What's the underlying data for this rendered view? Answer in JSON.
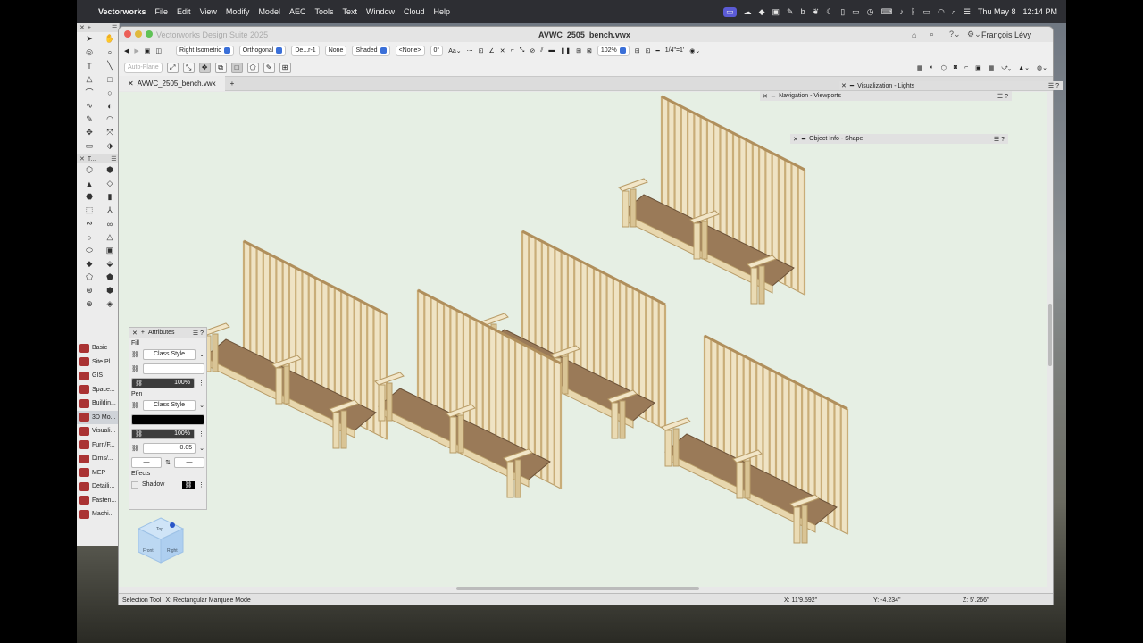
{
  "menubar": {
    "app": "Vectorworks",
    "items": [
      "File",
      "Edit",
      "View",
      "Modify",
      "Model",
      "AEC",
      "Tools",
      "Text",
      "Window",
      "Cloud",
      "Help"
    ],
    "date": "Thu May 8",
    "time": "12:14 PM"
  },
  "window": {
    "suite_title": "Vectorworks Design Suite 2025",
    "doc_title": "AVWC_2505_bench.vwx",
    "user": "François Lévy"
  },
  "toolbar": {
    "view": "Right Isometric",
    "projection": "Orthogonal",
    "layer": "De...r-1",
    "class": "None",
    "render": "Shaded",
    "none_sel": "<None>",
    "angle": "0°",
    "zoom": "102%",
    "scale": "1/4\"=1'",
    "auto_plane": "Auto-Plane"
  },
  "tab": {
    "label": "AVWC_2505_bench.vwx",
    "add": "+"
  },
  "palettes": {
    "viz": "Visualization - Lights",
    "nav": "Navigation - Viewports",
    "oip": "Object Info - Shape"
  },
  "attributes": {
    "title": "Attributes",
    "fill": "Fill",
    "fill_style": "Class Style",
    "fill_opacity": "100%",
    "pen": "Pen",
    "pen_style": "Class Style",
    "pen_opacity": "100%",
    "pen_weight": "0.05",
    "effects": "Effects",
    "shadow": "Shadow"
  },
  "workspaces": [
    "Basic",
    "Site Pl...",
    "GIS",
    "Space...",
    "Buildin...",
    "3D Mo...",
    "Visuali...",
    "Furn/F...",
    "Dims/...",
    "MEP",
    "Detaili...",
    "Fasten...",
    "Machi..."
  ],
  "tool_header": "T...",
  "status": {
    "tool": "Selection Tool",
    "mode": "X:  Rectangular Marquee Mode",
    "x": "X: 11'9.592\"",
    "y": "Y: -4.234\"",
    "z": "Z: 5'.266\""
  },
  "cube": {
    "top": "Top",
    "left": "Front",
    "right": "Right"
  }
}
